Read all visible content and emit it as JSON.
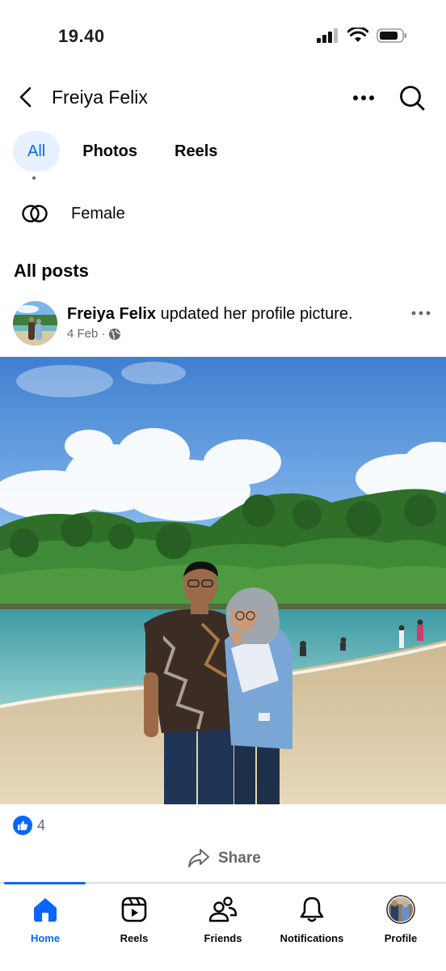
{
  "status_bar": {
    "time": "19.40"
  },
  "header": {
    "title": "Freiya Felix"
  },
  "tabs": [
    {
      "label": "All",
      "active": true
    },
    {
      "label": "Photos",
      "active": false
    },
    {
      "label": "Reels",
      "active": false
    }
  ],
  "about": {
    "gender": "Female"
  },
  "posts_section": {
    "title": "All posts"
  },
  "post": {
    "author": "Freiya Felix",
    "action": "updated her profile picture.",
    "date": "4 Feb",
    "separator": "·",
    "reaction_count": "4",
    "share_label": "Share"
  },
  "bottom_nav": [
    {
      "label": "Home",
      "icon": "home-icon",
      "active": true
    },
    {
      "label": "Reels",
      "icon": "reels-icon",
      "active": false
    },
    {
      "label": "Friends",
      "icon": "friends-icon",
      "active": false
    },
    {
      "label": "Notifications",
      "icon": "bell-icon",
      "active": false
    },
    {
      "label": "Profile",
      "icon": "profile-avatar",
      "active": false
    }
  ],
  "colors": {
    "accent": "#0866ff",
    "tab_active_bg": "#e7f0fd",
    "secondary_text": "#65676b"
  }
}
